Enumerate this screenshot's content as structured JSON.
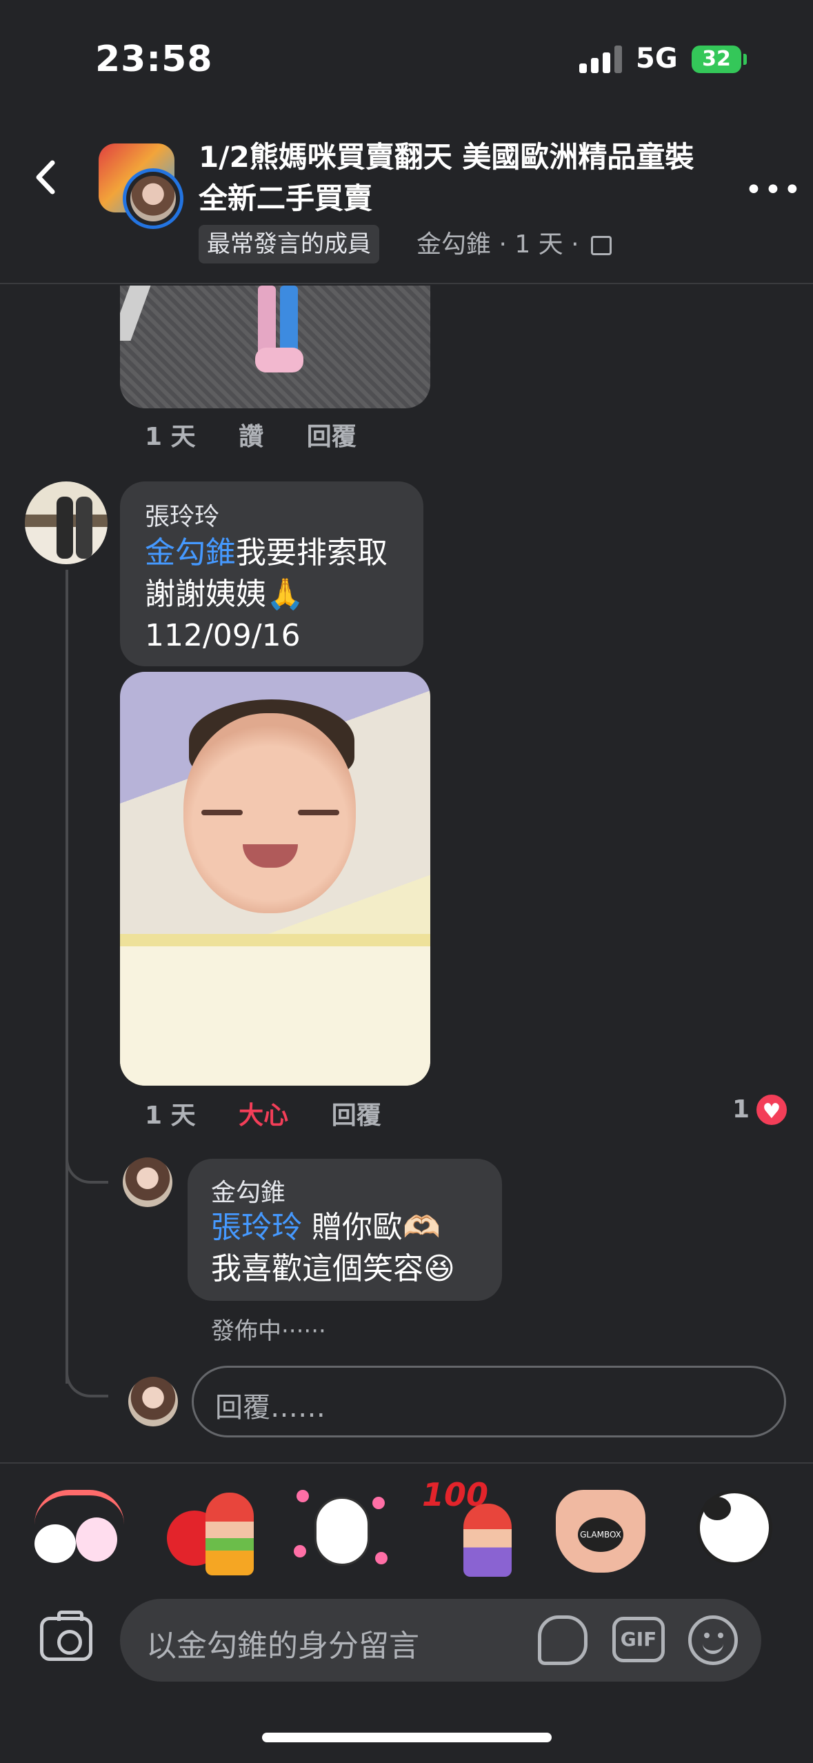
{
  "status_bar": {
    "time": "23:58",
    "network": "5G",
    "battery": "32"
  },
  "header": {
    "title": "1/2熊媽咪買賣翻天 美國歐洲精品童裝全新二手買賣",
    "badge": "最常發言的成員",
    "meta": "金勾錐 · 1 天 ·"
  },
  "first_comment": {
    "actions": [
      "1 天",
      "讚",
      "回覆"
    ]
  },
  "comment": {
    "author": "張玲玲",
    "mention": "金勾錐",
    "text_line1": "我要排索取",
    "text_line2": "謝謝姨姨🙏",
    "text_line3": "112/09/16",
    "time": "1 天",
    "reaction_label": "大心",
    "reply_label": "回覆",
    "like_count": "1"
  },
  "reply": {
    "author": "金勾錐",
    "mention": "張玲玲",
    "text_line1": " 贈你歐🫶🏻",
    "text_line2": "我喜歡這個笑容😆",
    "status": "發佈中······"
  },
  "reply_box": {
    "placeholder": "回覆……"
  },
  "composer": {
    "placeholder": "以金勾錐的身分留言",
    "gif": "GIF"
  },
  "stickers": [
    "kanahei-rainbow",
    "heart-hug-girl",
    "bear-hearts",
    "hundred-girl",
    "glambox-heart-hands",
    "cow-heart"
  ],
  "colors": {
    "background": "#232427",
    "bubble": "#3a3b3e",
    "mention": "#4599ff",
    "love": "#f33e58"
  }
}
